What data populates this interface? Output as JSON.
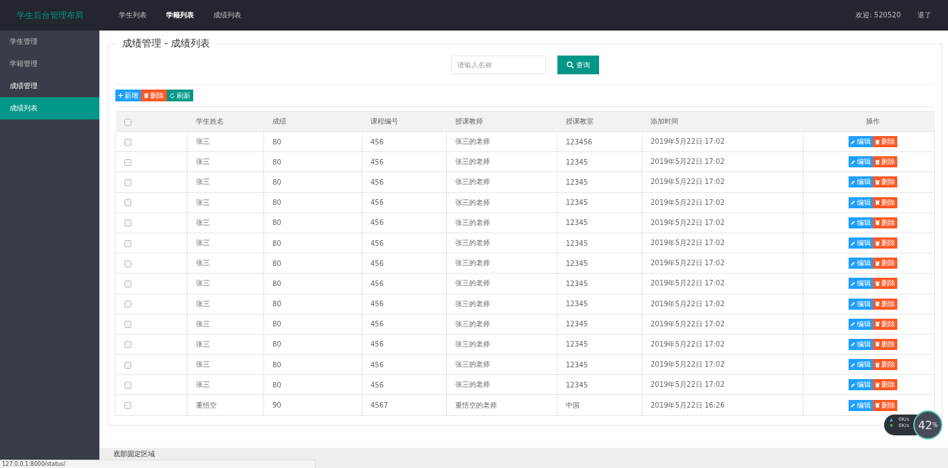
{
  "header": {
    "logo": "学生后台管理布局",
    "nav": [
      {
        "label": "学生列表",
        "selected": false
      },
      {
        "label": "学籍列表",
        "selected": true
      },
      {
        "label": "成绩列表",
        "selected": false
      }
    ],
    "welcome": "欢迎: 520520",
    "logout": "退了"
  },
  "sidebar": {
    "items": [
      {
        "label": "学生管理",
        "expanded": false,
        "selected": false
      },
      {
        "label": "学籍管理",
        "expanded": false,
        "selected": false
      },
      {
        "label": "成绩管理",
        "expanded": true,
        "selected": false,
        "children": [
          {
            "label": "成绩列表",
            "selected": true
          }
        ]
      }
    ]
  },
  "panel": {
    "title": "成绩管理 - 成绩列表",
    "search": {
      "placeholder": "请输入名称"
    },
    "search_button": "查询",
    "toolbar": [
      {
        "kind": "add",
        "label": "新增"
      },
      {
        "kind": "delete",
        "label": "删除"
      },
      {
        "kind": "refresh",
        "label": "刷新"
      }
    ]
  },
  "table": {
    "header_checked": false,
    "columns": [
      "学生姓名",
      "成绩",
      "课程编号",
      "授课教师",
      "授课教室",
      "添加时间",
      "操作"
    ],
    "rows": [
      {
        "checked": false,
        "cells": [
          "张三",
          "80",
          "456",
          "张三的老师",
          "123456",
          "2019年5月22日 17:02"
        ],
        "edit": "编辑",
        "delete": "删除"
      },
      {
        "checked": false,
        "cells": [
          "张三",
          "80",
          "456",
          "张三的老师",
          "12345",
          "2019年5月22日 17:02"
        ],
        "edit": "编辑",
        "delete": "删除"
      },
      {
        "checked": false,
        "cells": [
          "张三",
          "80",
          "456",
          "张三的老师",
          "12345",
          "2019年5月22日 17:02"
        ],
        "edit": "编辑",
        "delete": "删除"
      },
      {
        "checked": false,
        "cells": [
          "张三",
          "80",
          "456",
          "张三的老师",
          "12345",
          "2019年5月22日 17:02"
        ],
        "edit": "编辑",
        "delete": "删除"
      },
      {
        "checked": false,
        "cells": [
          "张三",
          "80",
          "456",
          "张三的老师",
          "12345",
          "2019年5月22日 17:02"
        ],
        "edit": "编辑",
        "delete": "删除"
      },
      {
        "checked": false,
        "cells": [
          "张三",
          "80",
          "456",
          "张三的老师",
          "12345",
          "2019年5月22日 17:02"
        ],
        "edit": "编辑",
        "delete": "删除"
      },
      {
        "checked": false,
        "cells": [
          "张三",
          "80",
          "456",
          "张三的老师",
          "12345",
          "2019年5月22日 17:02"
        ],
        "edit": "编辑",
        "delete": "删除"
      },
      {
        "checked": false,
        "cells": [
          "张三",
          "80",
          "456",
          "张三的老师",
          "12345",
          "2019年5月22日 17:02"
        ],
        "edit": "编辑",
        "delete": "删除"
      },
      {
        "checked": false,
        "cells": [
          "张三",
          "80",
          "456",
          "张三的老师",
          "12345",
          "2019年5月22日 17:02"
        ],
        "edit": "编辑",
        "delete": "删除"
      },
      {
        "checked": false,
        "cells": [
          "张三",
          "80",
          "456",
          "张三的老师",
          "12345",
          "2019年5月22日 17:02"
        ],
        "edit": "编辑",
        "delete": "删除"
      },
      {
        "checked": false,
        "cells": [
          "张三",
          "80",
          "456",
          "张三的老师",
          "12345",
          "2019年5月22日 17:02"
        ],
        "edit": "编辑",
        "delete": "删除"
      },
      {
        "checked": false,
        "cells": [
          "张三",
          "80",
          "456",
          "张三的老师",
          "12345",
          "2019年5月22日 17:02"
        ],
        "edit": "编辑",
        "delete": "删除"
      },
      {
        "checked": false,
        "cells": [
          "张三",
          "80",
          "456",
          "张三的老师",
          "12345",
          "2019年5月22日 17:02"
        ],
        "edit": "编辑",
        "delete": "删除"
      },
      {
        "checked": false,
        "cells": [
          "重悟空",
          "90",
          "4567",
          "重悟空的老师",
          "中国",
          "2019年5月22日 16:26"
        ],
        "edit": "编辑",
        "delete": "删除"
      }
    ]
  },
  "footer": "底部固定区域",
  "status_url": "127.0.0.1:8000/status/",
  "speed_widget": {
    "upload": "0K/s",
    "download": "0K/s",
    "value": "42",
    "unit": "%"
  }
}
